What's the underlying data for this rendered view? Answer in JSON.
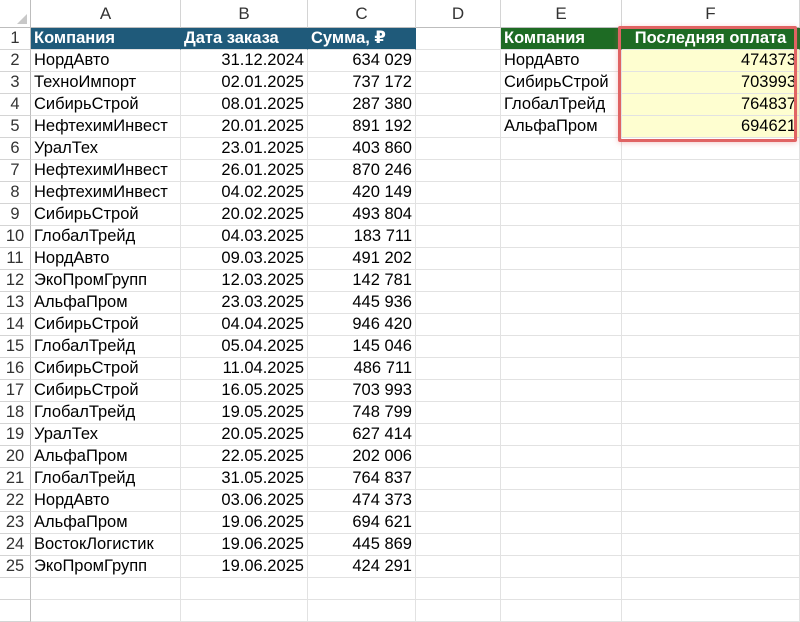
{
  "column_headers": [
    "A",
    "B",
    "C",
    "D",
    "E",
    "F"
  ],
  "row_numbers": [
    "1",
    "2",
    "3",
    "4",
    "5",
    "6",
    "7",
    "8",
    "9",
    "10",
    "11",
    "12",
    "13",
    "14",
    "15",
    "16",
    "17",
    "18",
    "19",
    "20",
    "21",
    "22",
    "23",
    "24",
    "25"
  ],
  "main_table": {
    "headers": [
      "Компания",
      "Дата заказа",
      "Сумма, ₽"
    ],
    "rows": [
      [
        "НордАвто",
        "31.12.2024",
        "634 029"
      ],
      [
        "ТехноИмпорт",
        "02.01.2025",
        "737 172"
      ],
      [
        "СибирьСтрой",
        "08.01.2025",
        "287 380"
      ],
      [
        "НефтехимИнвест",
        "20.01.2025",
        "891 192"
      ],
      [
        "УралТех",
        "23.01.2025",
        "403 860"
      ],
      [
        "НефтехимИнвест",
        "26.01.2025",
        "870 246"
      ],
      [
        "НефтехимИнвест",
        "04.02.2025",
        "420 149"
      ],
      [
        "СибирьСтрой",
        "20.02.2025",
        "493 804"
      ],
      [
        "ГлобалТрейд",
        "04.03.2025",
        "183 711"
      ],
      [
        "НордАвто",
        "09.03.2025",
        "491 202"
      ],
      [
        "ЭкоПромГрупп",
        "12.03.2025",
        "142 781"
      ],
      [
        "АльфаПром",
        "23.03.2025",
        "445 936"
      ],
      [
        "СибирьСтрой",
        "04.04.2025",
        "946 420"
      ],
      [
        "ГлобалТрейд",
        "05.04.2025",
        "145 046"
      ],
      [
        "СибирьСтрой",
        "11.04.2025",
        "486 711"
      ],
      [
        "СибирьСтрой",
        "16.05.2025",
        "703 993"
      ],
      [
        "ГлобалТрейд",
        "19.05.2025",
        "748 799"
      ],
      [
        "УралТех",
        "20.05.2025",
        "627 414"
      ],
      [
        "АльфаПром",
        "22.05.2025",
        "202 006"
      ],
      [
        "ГлобалТрейд",
        "31.05.2025",
        "764 837"
      ],
      [
        "НордАвто",
        "03.06.2025",
        "474 373"
      ],
      [
        "АльфаПром",
        "19.06.2025",
        "694 621"
      ],
      [
        "ВостокЛогистик",
        "19.06.2025",
        "445 869"
      ],
      [
        "ЭкоПромГрупп",
        "19.06.2025",
        "424 291"
      ]
    ]
  },
  "summary_table": {
    "headers": [
      "Компания",
      "Последняя оплата"
    ],
    "rows": [
      [
        "НордАвто",
        "474373"
      ],
      [
        "СибирьСтрой",
        "703993"
      ],
      [
        "ГлобалТрейд",
        "764837"
      ],
      [
        "АльфаПром",
        "694621"
      ]
    ]
  },
  "colors": {
    "main_header_bg": "#1f5a7a",
    "summary_header_bg": "#1e6b24",
    "highlight_fill": "#fefed0",
    "selection_border": "#e06363"
  },
  "icons": {
    "select_all": "select-all-triangle-icon"
  }
}
